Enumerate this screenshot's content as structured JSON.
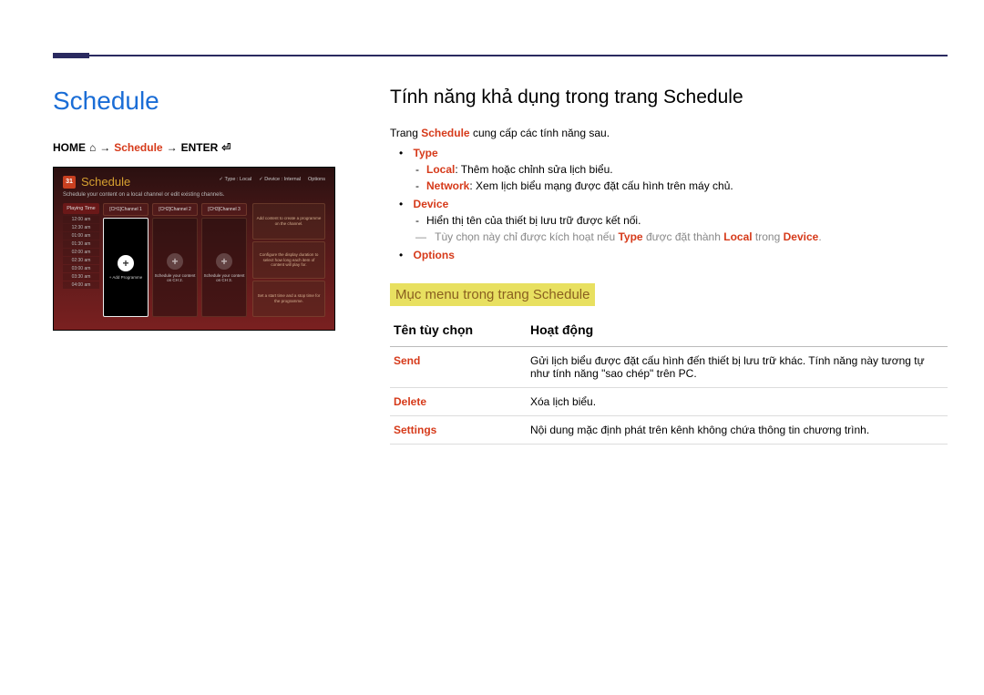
{
  "left": {
    "title": "Schedule",
    "breadcrumb": {
      "home": "HOME",
      "arrow1": "→",
      "mid": "Schedule",
      "arrow2": "→",
      "enter": "ENTER"
    }
  },
  "screenshot": {
    "cal_num": "31",
    "title": "Schedule",
    "top_type": "Type : Local",
    "top_device": "Device : Internal",
    "top_options": "Options",
    "subtitle": "Schedule your content on a local channel or edit existing channels.",
    "th_time": "Playing Time",
    "times": [
      "12:00 am",
      "12:30 am",
      "01:00 am",
      "01:30 am",
      "02:00 am",
      "02:30 am",
      "03:00 am",
      "03:30 am",
      "04:00 am"
    ],
    "ch1": "[CH1]Channel 1",
    "ch2": "[CH2]Channel 2",
    "ch3": "[CH3]Channel 3",
    "ch1_label": "+ Add Programme",
    "ch2_label": "Schedule your content on CH 2.",
    "ch3_label": "Schedule your content on CH 3.",
    "side1": "Add content to create a programme on the channel.",
    "side2": "Configure the display duration to select how long each item of content will play for.",
    "side3": "Set a start time and a stop time for the programme."
  },
  "right": {
    "title": "Tính năng khả dụng trong trang Schedule",
    "intro_pre": "Trang ",
    "intro_hl": "Schedule",
    "intro_post": " cung cấp các tính năng sau.",
    "type": "Type",
    "type_local_k": "Local",
    "type_local_v": ": Thêm hoặc chỉnh sửa lịch biểu.",
    "type_network_k": "Network",
    "type_network_v": ": Xem lịch biểu mạng được đặt cấu hình trên máy chủ.",
    "device": "Device",
    "device_desc": "Hiển thị tên của thiết bị lưu trữ được kết nối.",
    "note_pre": "Tùy chọn này chỉ được kích hoạt nếu ",
    "note_type": "Type",
    "note_mid": " được đặt thành ",
    "note_local": "Local",
    "note_mid2": " trong ",
    "note_device": "Device",
    "note_end": ".",
    "options": "Options",
    "section": "Mục menu trong trang Schedule",
    "th1": "Tên tùy chọn",
    "th2": "Hoạt động",
    "rows": [
      {
        "k": "Send",
        "v": "Gửi lịch biểu được đặt cấu hình đến thiết bị lưu trữ khác. Tính năng này tương tự như tính năng \"sao chép\" trên PC."
      },
      {
        "k": "Delete",
        "v": "Xóa lịch biểu."
      },
      {
        "k": "Settings",
        "v": "Nội dung mặc định phát trên kênh không chứa thông tin chương trình."
      }
    ]
  }
}
